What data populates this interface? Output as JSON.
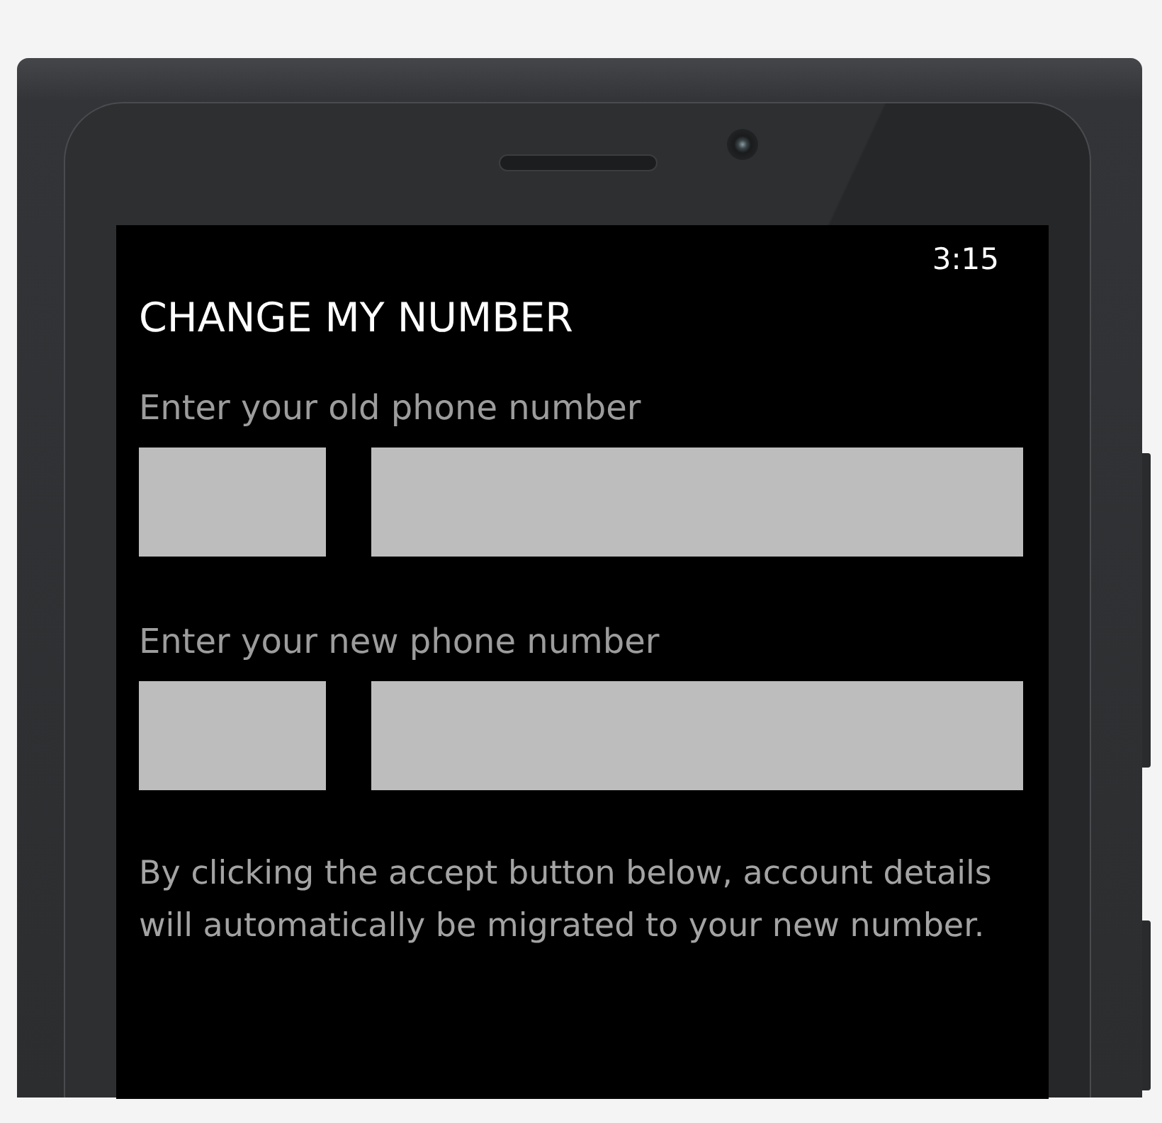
{
  "status_bar": {
    "time": "3:15"
  },
  "page": {
    "title": "CHANGE MY NUMBER"
  },
  "phone_fields": [
    {
      "label": "Enter your old phone number"
    },
    {
      "label": "Enter your new phone number"
    }
  ],
  "notice": "By clicking the accept button below, account details will automatically be migrated to your new number."
}
